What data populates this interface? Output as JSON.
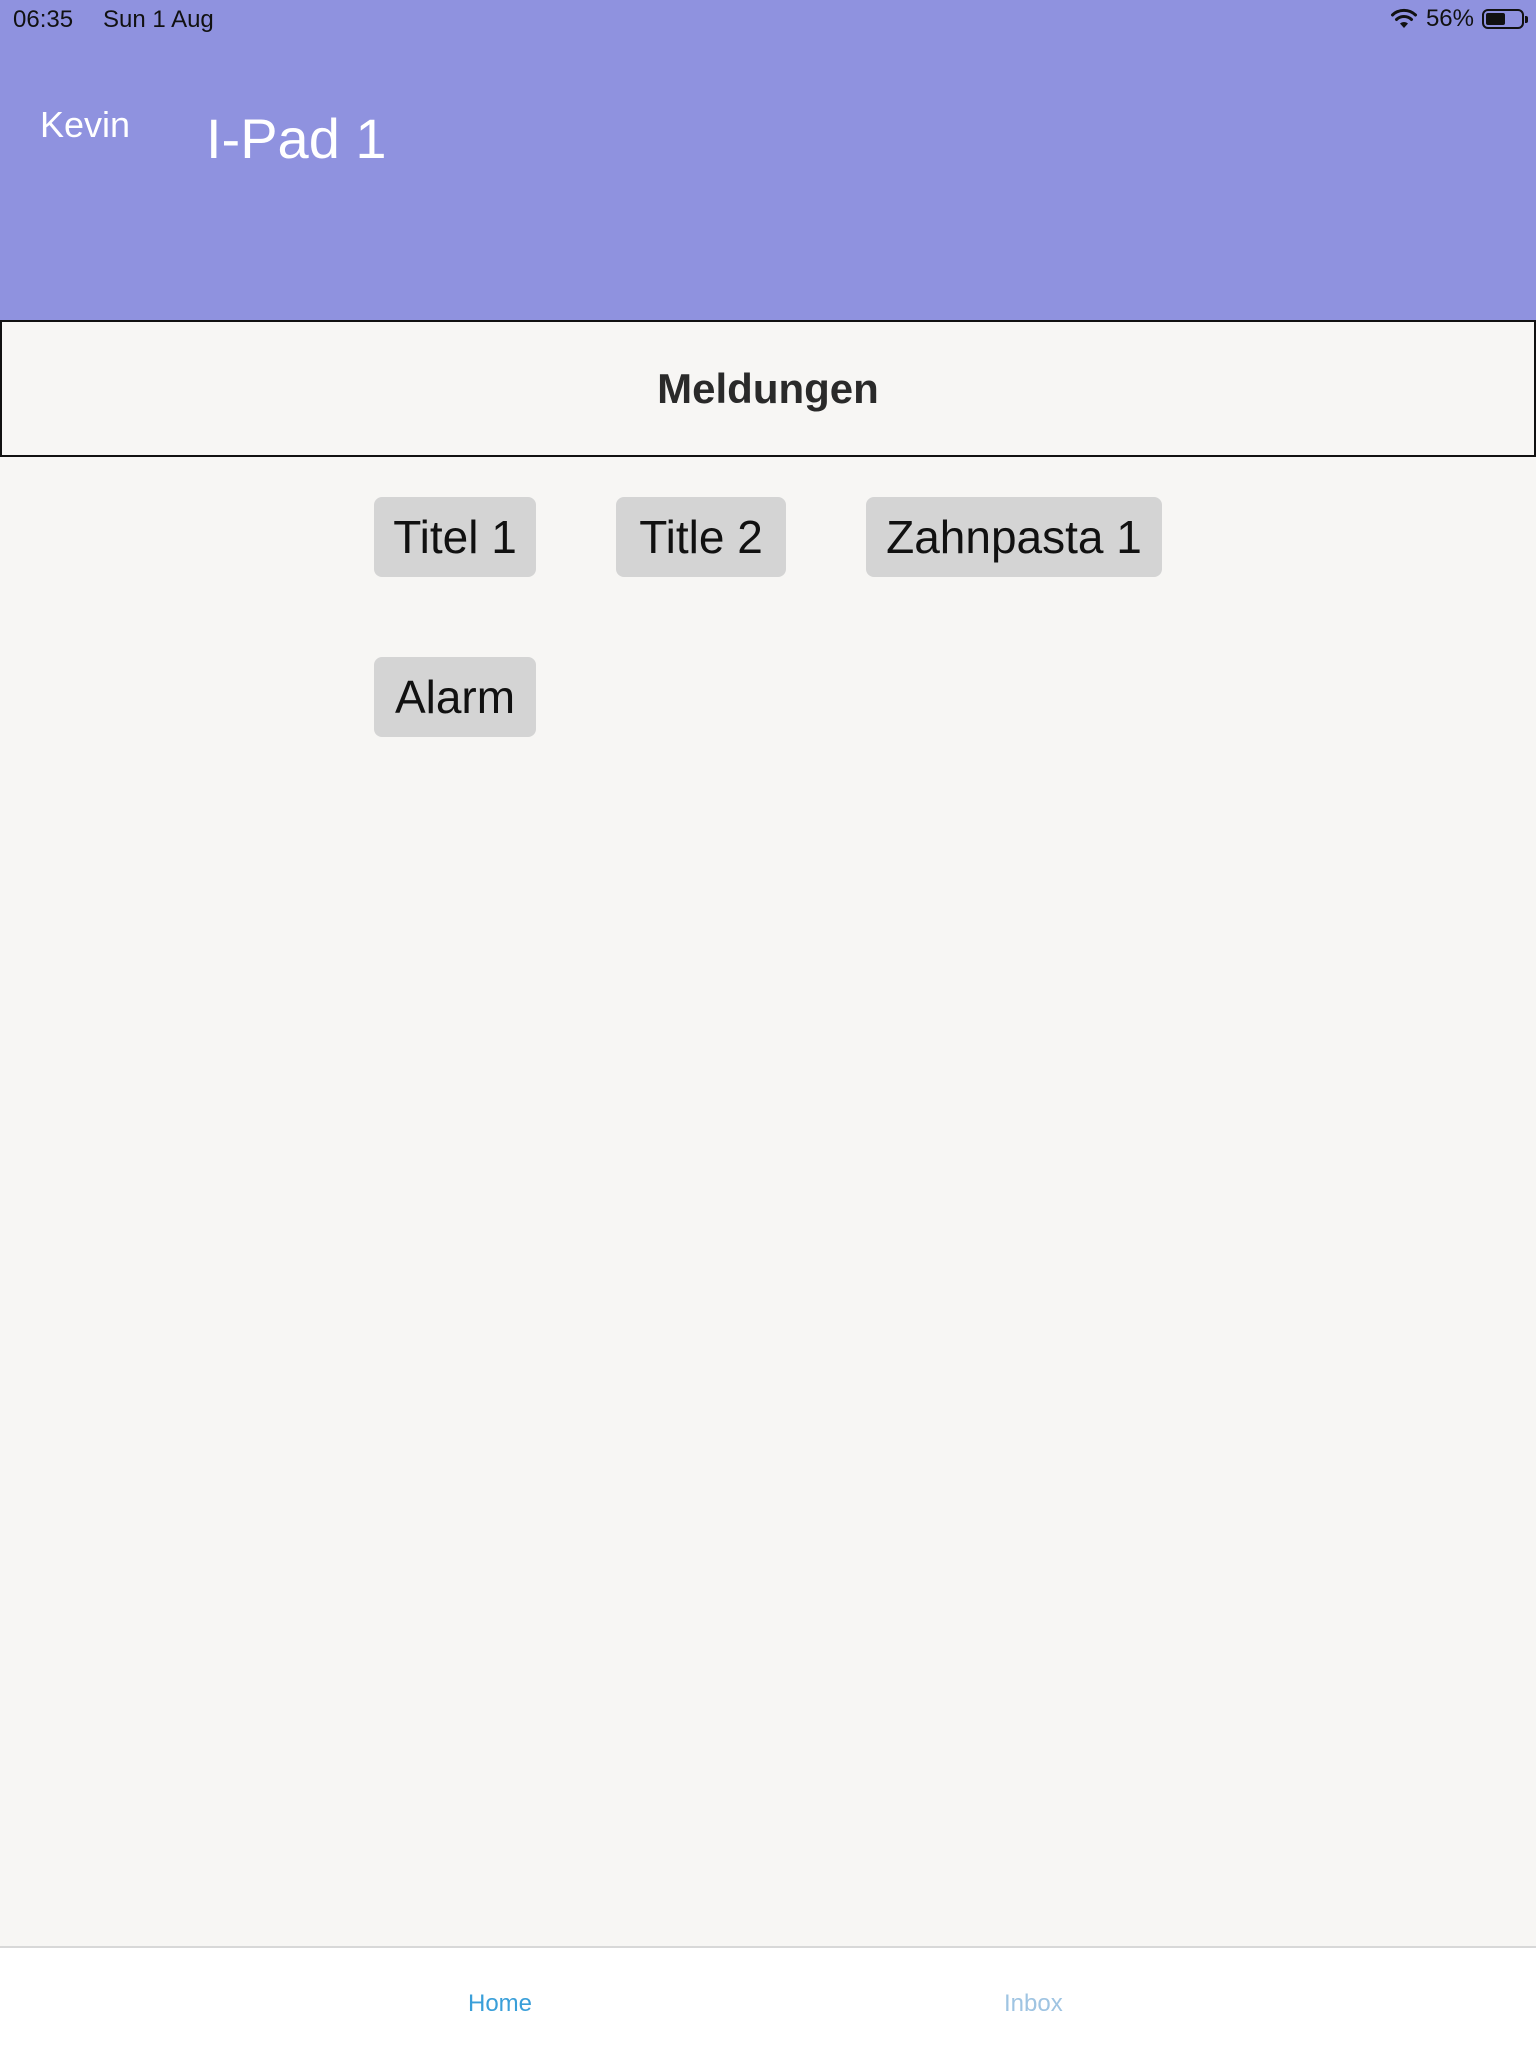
{
  "status_bar": {
    "time": "06:35",
    "date": "Sun 1 Aug",
    "battery": "56%",
    "battery_level": 0.56,
    "icons": [
      "wifi-icon",
      "battery-icon"
    ]
  },
  "header": {
    "user": "Kevin",
    "title": "I-Pad 1",
    "color": "#8f92df"
  },
  "section": {
    "title": "Meldungen"
  },
  "messages": [
    {
      "label": "Titel 1"
    },
    {
      "label": "Title 2"
    },
    {
      "label": "Zahnpasta 1"
    },
    {
      "label": "Alarm"
    }
  ],
  "tabbar": {
    "tabs": [
      {
        "label": "Home",
        "color": "#3a9fd9",
        "active": true
      },
      {
        "label": "Inbox",
        "color": "#9fc4e2",
        "active": false
      }
    ]
  }
}
